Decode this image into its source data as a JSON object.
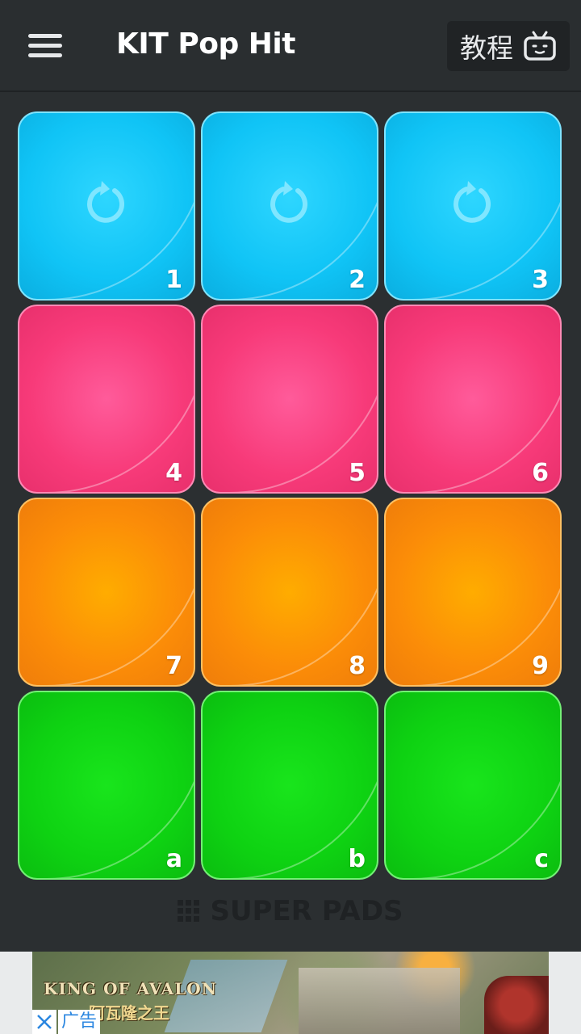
{
  "header": {
    "title": "KIT Pop Hit",
    "tutorial_label": "教程",
    "menu_icon": "hamburger-menu-icon",
    "tutorial_icon": "tv-icon"
  },
  "pads": [
    {
      "key": "1",
      "color": "blue",
      "icon": "loop-icon"
    },
    {
      "key": "2",
      "color": "blue",
      "icon": "loop-icon"
    },
    {
      "key": "3",
      "color": "blue",
      "icon": "loop-icon"
    },
    {
      "key": "4",
      "color": "pink"
    },
    {
      "key": "5",
      "color": "pink"
    },
    {
      "key": "6",
      "color": "pink"
    },
    {
      "key": "7",
      "color": "orange"
    },
    {
      "key": "8",
      "color": "orange"
    },
    {
      "key": "9",
      "color": "orange"
    },
    {
      "key": "a",
      "color": "green"
    },
    {
      "key": "b",
      "color": "green"
    },
    {
      "key": "c",
      "color": "green"
    }
  ],
  "colors": {
    "blue": "#10c4f6",
    "pink": "#f73a79",
    "orange": "#fb8c08",
    "green": "#0ed212",
    "background": "#2b2f31"
  },
  "footer": {
    "super_pads_label": "SUPER PADS",
    "super_pads_icon": "grid-icon"
  },
  "ad": {
    "title": "KING OF AVALON",
    "subtitle": "阿瓦隆之王",
    "label": "广告",
    "close_icon": "close-icon"
  }
}
